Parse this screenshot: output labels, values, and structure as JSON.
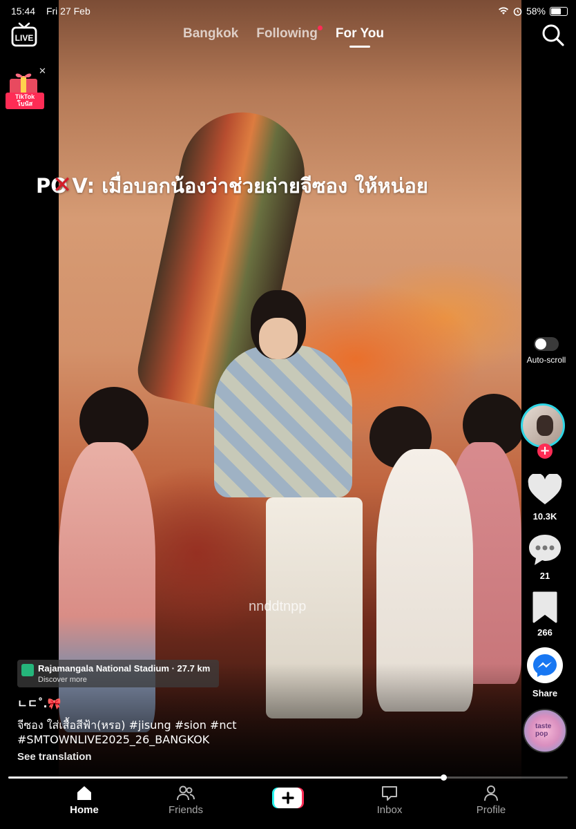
{
  "status_bar": {
    "time": "15:44",
    "date": "Fri 27 Feb",
    "battery": "58%"
  },
  "top_tabs": [
    {
      "label": "Bangkok"
    },
    {
      "label": "Following"
    },
    {
      "label": "For You"
    }
  ],
  "promo": {
    "label": "TikTok\nโบนัส"
  },
  "video": {
    "overlay_text_prefix": "P",
    "overlay_text_crossed": "O",
    "overlay_text_suffix": "V: เมื่อบอกน้องว่าช่วยถ่ายจีซอง ให้หน่อย",
    "watermark": "nnddtnpp",
    "progress_percent": 77.8
  },
  "right_rail": {
    "auto_scroll_label": "Auto-scroll",
    "likes": "10.3K",
    "comments": "21",
    "saves": "266",
    "share_label": "Share",
    "music_disc_text": "taste\npop"
  },
  "location": {
    "title": "Rajamangala National Stadium · 27.7 km",
    "subtitle": "Discover more"
  },
  "post": {
    "username": "ㄴㄷ˚.🎀",
    "caption_line1": "จีซอง ใส่เสื้อสีฟ้า(หรอ) #jisung #sion #nct",
    "caption_line2": "#SMTOWNLIVE2025_26_BANGKOK",
    "see_translation": "See translation"
  },
  "bottom_nav": [
    {
      "label": "Home"
    },
    {
      "label": "Friends"
    },
    {
      "label": ""
    },
    {
      "label": "Inbox"
    },
    {
      "label": "Profile"
    }
  ],
  "colors": {
    "accent": "#fe2c55",
    "avatar_ring": "#2fd6e6",
    "messenger": "#1877f2"
  }
}
